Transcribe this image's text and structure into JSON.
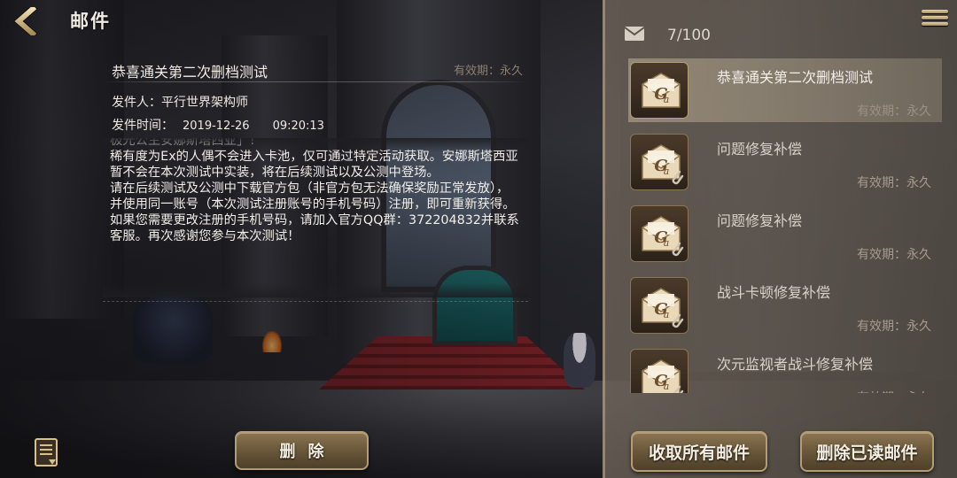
{
  "header": {
    "title": "邮件"
  },
  "detail": {
    "subject": "恭喜通关第二次删档测试",
    "validity": "有效期：永久",
    "sender_label": "发件人：",
    "sender_name": "平行世界架构师",
    "time_label": "发件时间：",
    "date": "2019-12-26",
    "time": "09:20:13",
    "body": "极光公主安娜斯塔西亚」！\n稀有度为Ex的人偶不会进入卡池，仅可通过特定活动获取。安娜斯塔西亚暂不会在本次测试中实装，将在后续测试以及公测中登场。\n请在后续测试及公测中下载官方包（非官方包无法确保奖励正常发放），并使用同一账号（本次测试注册账号的手机号码）注册，即可重新获得。\n如果您需要更改注册的手机号码，请加入官方QQ群：372204832并联系客服。再次感谢您参与本次测试！"
  },
  "actions": {
    "delete_label": "删除",
    "collect_all_label": "收取所有邮件",
    "delete_read_label": "删除已读邮件"
  },
  "inbox": {
    "count": "7/100",
    "items": [
      {
        "title": "恭喜通关第二次删档测试",
        "validity": "有效期：永久",
        "selected": true,
        "attachment": false
      },
      {
        "title": "问题修复补偿",
        "validity": "有效期：永久",
        "selected": false,
        "attachment": true
      },
      {
        "title": "问题修复补偿",
        "validity": "有效期：永久",
        "selected": false,
        "attachment": true
      },
      {
        "title": "战斗卡顿修复补偿",
        "validity": "有效期：永久",
        "selected": false,
        "attachment": true
      },
      {
        "title": "次元监视者战斗修复补偿",
        "validity": "有效期：永久",
        "selected": false,
        "attachment": true
      }
    ]
  },
  "icons": {
    "back": "back-arrow-icon",
    "notes": "notes-icon",
    "envelope": "envelope-icon",
    "menu": "menu-icon",
    "mail": "mail-envelope-icon",
    "attachment": "paperclip-icon"
  },
  "colors": {
    "accent_gold": "#b39d74",
    "button_brown": "#6d5a3c",
    "panel_tan": "#6e6458"
  }
}
